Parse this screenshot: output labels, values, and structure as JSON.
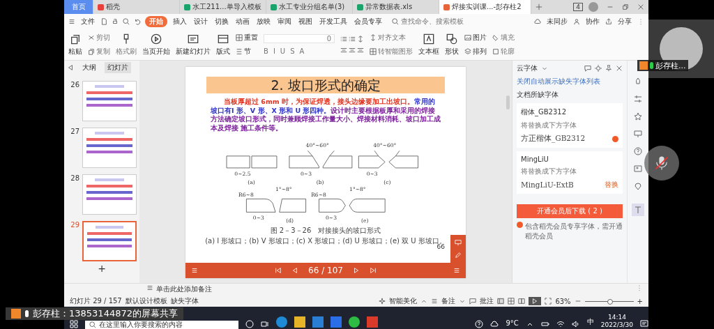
{
  "tabs": [
    {
      "label": "首页",
      "kind": "home",
      "selected": false
    },
    {
      "label": "稻壳",
      "kind": "docer",
      "selected": false
    },
    {
      "label": "水工211...单导入模板",
      "kind": "sheet",
      "selected": false
    },
    {
      "label": "水工专业分组名单(3)",
      "kind": "sheet",
      "selected": false
    },
    {
      "label": "异常数据表.xls",
      "kind": "sheet",
      "selected": false
    },
    {
      "label": "焊接实训课...-彭存柱2",
      "kind": "slides",
      "selected": true
    }
  ],
  "tab_count": "4",
  "menu": {
    "file": "文件",
    "items": [
      {
        "label": "开始",
        "selected": true
      },
      {
        "label": "插入",
        "selected": false
      },
      {
        "label": "设计",
        "selected": false
      },
      {
        "label": "切换",
        "selected": false
      },
      {
        "label": "动画",
        "selected": false
      },
      {
        "label": "放映",
        "selected": false
      },
      {
        "label": "审阅",
        "selected": false
      },
      {
        "label": "视图",
        "selected": false
      },
      {
        "label": "开发工具",
        "selected": false
      },
      {
        "label": "会员专享",
        "selected": false
      }
    ],
    "search_placeholder": "查找命令、搜索模板",
    "actions": [
      "未同步",
      "协作",
      "分享"
    ]
  },
  "ribbon": {
    "paste": "粘贴",
    "cut": "剪切",
    "copy": "复制",
    "format_painter": "格式刷",
    "play": "当页开始",
    "new_slide": "新建幻灯片",
    "layout": "版式",
    "reset": "重置",
    "section": "节",
    "font_size": "0",
    "format_buttons": [
      "B",
      "I",
      "U",
      "S",
      "A"
    ],
    "align_text": "对齐文本",
    "smart_art": "转智能图形",
    "text_box": "文本框",
    "shape": "形状",
    "picture": "图片",
    "arrange": "排列",
    "fill": "填充",
    "outline": "轮廓"
  },
  "slide_panel": {
    "tabs": [
      {
        "label": "大纲",
        "selected": false
      },
      {
        "label": "幻灯片",
        "selected": true
      }
    ],
    "slides": [
      {
        "number": "26",
        "selected": false
      },
      {
        "number": "27",
        "selected": false
      },
      {
        "number": "28",
        "selected": false
      },
      {
        "number": "29",
        "selected": true
      }
    ],
    "add": "+"
  },
  "slide": {
    "title": "2. 坡口形式的确定",
    "paragraph": [
      {
        "kind": "warning",
        "text": "当板厚超过 6mm 时，为保证焊透，接头边缘要加工出坡口。"
      },
      {
        "kind": "emphasis",
        "text": "常用的坡口有I 形、V 形、X 形和 U 形四种。"
      },
      {
        "kind": "body",
        "text": "设计时主要根据板厚和采用的焊接方法确定坡口形式，同时兼顾焊接工作量大小、焊接材料消耗、坡口加工成本及焊接 施工条件等。"
      }
    ],
    "diagram_labels": [
      "40°~60°",
      "40°~60°",
      "1°~8°",
      "1°~8°",
      "R6~8",
      "R6~8",
      "0~2.5",
      "0~3",
      "0~3",
      "0~3",
      "0~3",
      "(a)",
      "(b)",
      "(c)",
      "(d)",
      "(e)"
    ],
    "caption": "图 2－3－26　对接接头的坡口形式",
    "subcaption": "(a) I 形坡口；(b) V 形坡口；(c) X 形坡口；(d) U 形坡口；(e) 双 U 形坡口。",
    "page_number": "66",
    "position": "66 / 107"
  },
  "notes_placeholder": "单击此处添加备注",
  "font_panel": {
    "title": "云字体",
    "link": "关闭自动展示缺失字体列表",
    "section": "文档所缺字体",
    "fonts": [
      {
        "name": "楷体_GB2312",
        "hint": "将替换成下方字体",
        "replacement": "方正楷体_GB2312",
        "premium": true
      },
      {
        "name": "MingLiU",
        "hint": "将替换成下方字体",
        "replacement": "MingLiU-ExtB",
        "premium": false,
        "action": "替换"
      }
    ],
    "button": "开通会员后下载 ( 2 )",
    "note": "包含稻壳会员专享字体，需开通稻壳会员"
  },
  "status": {
    "slide_info": "幻灯片 29 / 157",
    "template": "默认设计模板",
    "missing": "缺失字体",
    "beautify": "智能美化",
    "notes": "备注",
    "comments": "批注",
    "zoom": "63%",
    "zoom_slider": {
      "level": 0.5
    },
    "zoom_in": "+"
  },
  "taskbar": {
    "search_placeholder": "在这里输入你要搜索的内容",
    "weather": "9°C",
    "ime": "中",
    "time": "14:14",
    "date": "2022/3/30"
  },
  "meeting": {
    "share_banner": "彭存柱：13853144872的屏幕共享",
    "participant": "彭存柱...",
    "muted": true
  }
}
